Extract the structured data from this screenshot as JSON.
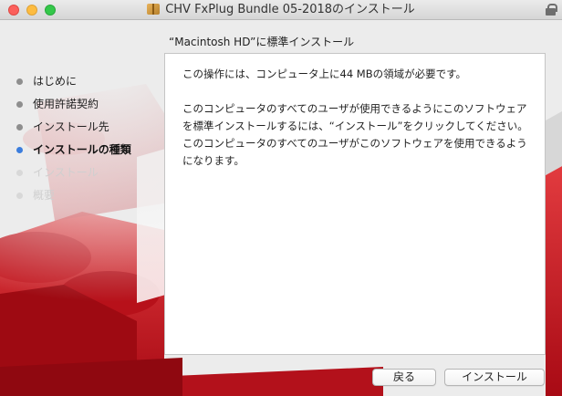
{
  "window": {
    "title": "CHV FxPlug Bundle 05-2018のインストール"
  },
  "heading": "“Macintosh HD”に標準インストール",
  "steps": [
    {
      "label": "はじめに",
      "state": "done"
    },
    {
      "label": "使用許諾契約",
      "state": "done"
    },
    {
      "label": "インストール先",
      "state": "done"
    },
    {
      "label": "インストールの種類",
      "state": "current"
    },
    {
      "label": "インストール",
      "state": "future"
    },
    {
      "label": "概要",
      "state": "future"
    }
  ],
  "panel": {
    "paragraph1": "この操作には、コンピュータ上に44 MBの領域が必要です。",
    "paragraph2": "このコンピュータのすべてのユーザが使用できるようにこのソフトウェアを標準インストールするには、“インストール”をクリックしてください。このコンピュータのすべてのユーザがこのソフトウェアを使用できるようになります。"
  },
  "buttons": {
    "back": "戻る",
    "install": "インストール"
  },
  "colors": {
    "accent": "#3b7ddd",
    "lego_red": "#c8121c"
  },
  "icons": [
    "package-icon",
    "lock-icon"
  ]
}
